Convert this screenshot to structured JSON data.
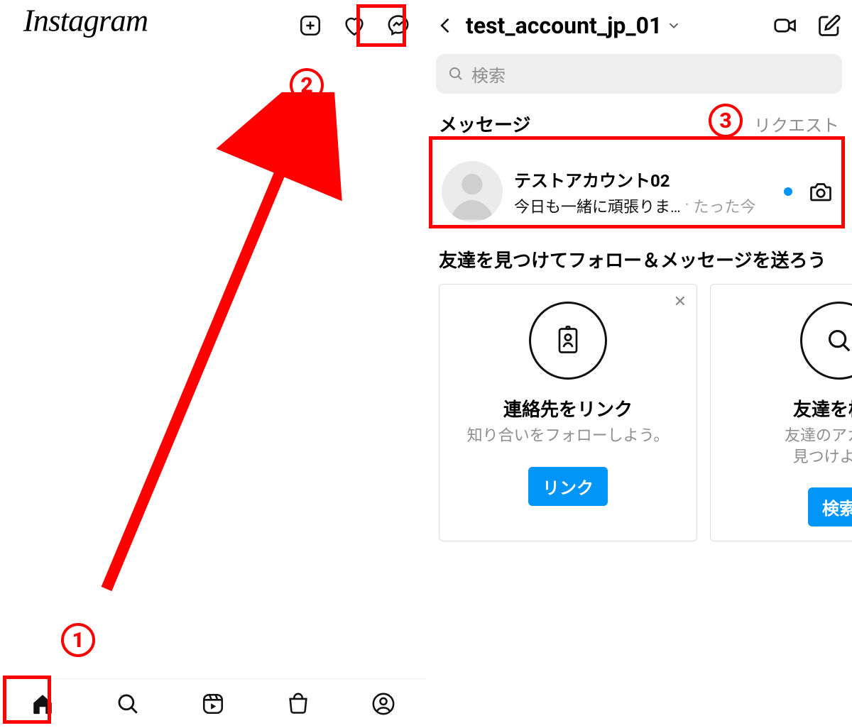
{
  "logo_text": "Instagram",
  "dm": {
    "account": "test_account_jp_01",
    "search_placeholder": "検索",
    "section_title": "メッセージ",
    "requests_label": "リクエスト",
    "conversation": {
      "name": "テストアカウント02",
      "snippet": "今日も一緒に頑張りま…",
      "time": "たった今"
    },
    "friends_title": "友達を見つけてフォロー＆メッセージを送ろう",
    "card_contacts": {
      "title": "連絡先をリンク",
      "subtitle": "知り合いをフォローしよう。",
      "button": "リンク"
    },
    "card_search": {
      "title": "友達を検索",
      "subtitle": "友達のアカウン\n見つけよう。",
      "button": "検索"
    }
  },
  "annotations": {
    "step1": "1",
    "step2": "2",
    "step3": "3"
  }
}
